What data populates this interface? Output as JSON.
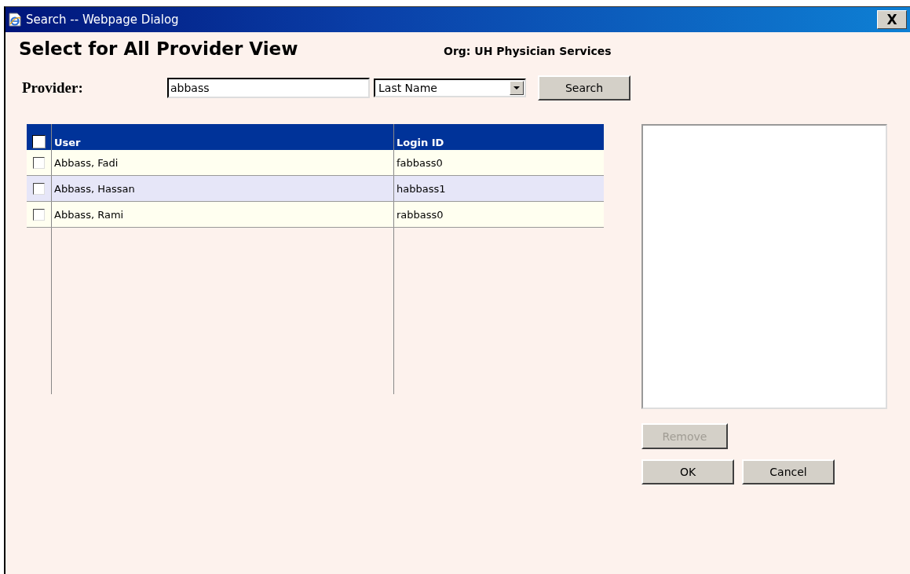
{
  "window": {
    "title": "Search -- Webpage Dialog",
    "close": "X"
  },
  "heading": "Select for All Provider View",
  "org": "Org: UH Physician Services",
  "search": {
    "label": "Provider:",
    "value": "abbass",
    "field": "Last Name",
    "button": "Search"
  },
  "table": {
    "select_all": {
      "checked": false
    },
    "columns": [
      "User",
      "Login ID"
    ],
    "rows": [
      {
        "checked": false,
        "user": "Abbass, Fadi",
        "login": "fabbass0"
      },
      {
        "checked": false,
        "user": "Abbass, Hassan",
        "login": "habbass1"
      },
      {
        "checked": false,
        "user": "Abbass, Rami",
        "login": "rabbass0"
      }
    ]
  },
  "buttons": {
    "remove": {
      "label": "Remove",
      "disabled": true
    },
    "ok": "OK",
    "cancel": "Cancel"
  }
}
